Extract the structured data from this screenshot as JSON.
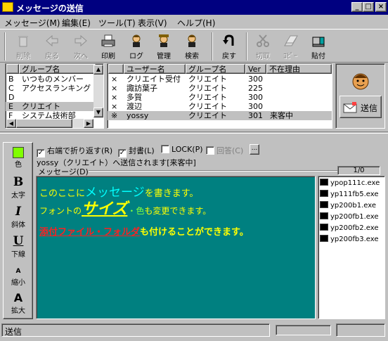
{
  "window": {
    "title": "メッセージの送信"
  },
  "menu": [
    "メッセージ(M)",
    "編集(E)",
    "ツール(T)",
    "表示(V)",
    "ヘルプ(H)"
  ],
  "toolbar": [
    {
      "label": "削除",
      "icon": "trash-icon",
      "enabled": false
    },
    {
      "label": "戻る",
      "icon": "back-arrow-icon",
      "enabled": false
    },
    {
      "label": "次へ",
      "icon": "forward-arrow-icon",
      "enabled": false
    },
    {
      "label": "印刷",
      "icon": "printer-icon",
      "enabled": true
    },
    {
      "label": "ログ",
      "icon": "log-person-icon",
      "enabled": true
    },
    {
      "label": "管理",
      "icon": "admin-person-icon",
      "enabled": true
    },
    {
      "label": "検索",
      "icon": "search-person-icon",
      "enabled": true
    },
    {
      "label": "戻す",
      "icon": "undo-icon",
      "enabled": true
    },
    {
      "label": "切取",
      "icon": "scissors-icon",
      "enabled": false
    },
    {
      "label": "ｺﾋﾟｰ",
      "icon": "copy-icon",
      "enabled": false
    },
    {
      "label": "貼付",
      "icon": "paste-icon",
      "enabled": true
    }
  ],
  "groups": {
    "header": "グループ名",
    "rows": [
      {
        "key": "B",
        "name": "いつものメンバー",
        "selected": false
      },
      {
        "key": "C",
        "name": "アクセスランキング",
        "selected": false
      },
      {
        "key": "D",
        "name": "",
        "selected": false
      },
      {
        "key": "E",
        "name": "クリエイト",
        "selected": true
      },
      {
        "key": "F",
        "name": "システム技術部",
        "selected": false
      }
    ]
  },
  "users": {
    "columns": [
      "ユーザー名",
      "グループ名",
      "Ver",
      "不在理由"
    ],
    "rows": [
      {
        "mark": "×",
        "name": "クリエイト受付",
        "group": "クリエイト",
        "ver": "300",
        "reason": ""
      },
      {
        "mark": "×",
        "name": "諏訪葉子",
        "group": "クリエイト",
        "ver": "225",
        "reason": ""
      },
      {
        "mark": "×",
        "name": "多賀",
        "group": "クリエイト",
        "ver": "300",
        "reason": ""
      },
      {
        "mark": "×",
        "name": "渡辺",
        "group": "クリエイト",
        "ver": "300",
        "reason": ""
      },
      {
        "mark": "※",
        "name": "yossy",
        "group": "クリエイト",
        "ver": "301",
        "reason": "来客中"
      }
    ]
  },
  "send_button": "送信",
  "options": {
    "wrap": "右端で折り返す(R)",
    "seal": "封書(L)",
    "lock": "LOCK(P)",
    "reply": "回答(C)",
    "more": "..."
  },
  "recipient_text": "yossy（クリエイト）へ送信されます[来客中]",
  "message_label": "メッセージ(D)",
  "page_counter": "1/0",
  "format_buttons": [
    {
      "label": "色",
      "glyph": ""
    },
    {
      "label": "太字",
      "glyph": "B"
    },
    {
      "label": "斜体",
      "glyph": "I"
    },
    {
      "label": "下線",
      "glyph": "U"
    },
    {
      "label": "縮小",
      "glyph": "A"
    },
    {
      "label": "拡大",
      "glyph": "A"
    }
  ],
  "message": {
    "line1_a": "このここに",
    "line1_b": "メッセージ",
    "line1_c": "を書きます。",
    "line2_a": "フォントの",
    "line2_b": "サイズ",
    "line2_c": "・",
    "line2_d": "色",
    "line2_e": "も変更できます。",
    "line3_a": "添付ファイル・フォルダ",
    "line3_b": "も付けることができます。"
  },
  "colors": {
    "message_bg": "#008080",
    "title_bg": "#000080",
    "cyan_text": "#00ffff",
    "yellow_text": "#ffff00",
    "red_text": "#ff2020"
  },
  "attachments": [
    "ypop111c.exe",
    "yp111fb5.exe",
    "yp200b1.exe",
    "yp200fb1.exe",
    "yp200fb2.exe",
    "yp200fb3.exe"
  ],
  "status": "送信"
}
